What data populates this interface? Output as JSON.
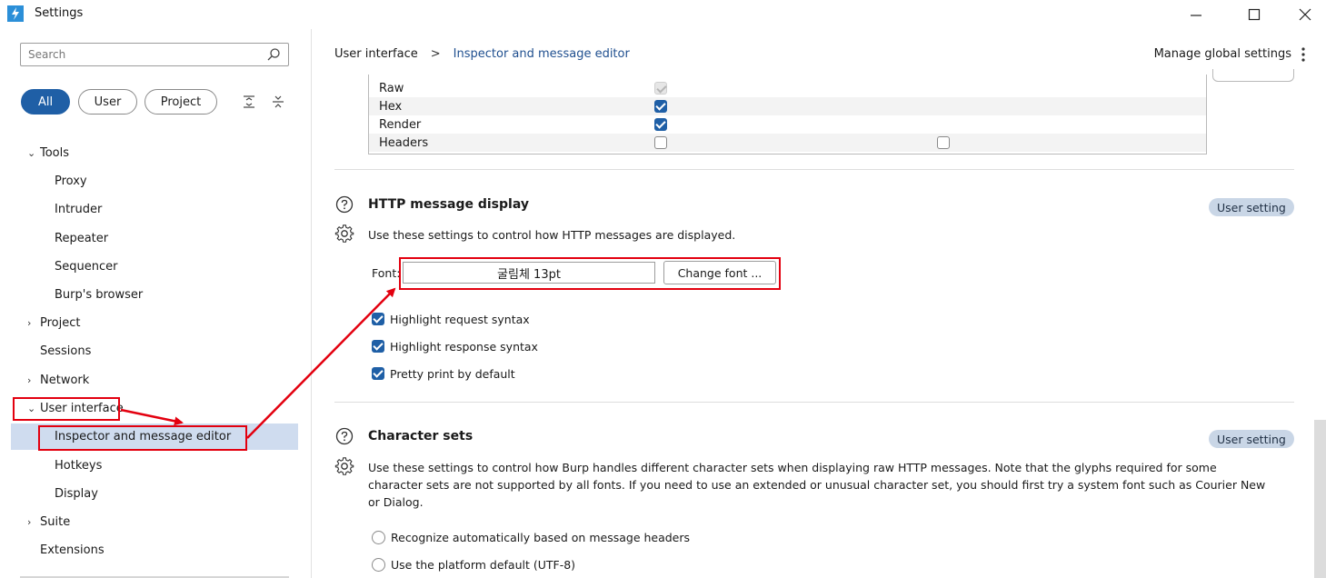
{
  "window": {
    "title": "Settings",
    "minimize_glyph": "—",
    "close_glyph": "✕"
  },
  "sidebar": {
    "search_placeholder": "Search",
    "filters": {
      "all": "All",
      "user": "User",
      "project": "Project",
      "active": "All"
    },
    "tree": [
      {
        "label": "Tools",
        "chevron": "⌄"
      },
      {
        "label": "Proxy"
      },
      {
        "label": "Intruder"
      },
      {
        "label": "Repeater"
      },
      {
        "label": "Sequencer"
      },
      {
        "label": "Burp's browser"
      },
      {
        "label": "Project",
        "chevron": "›"
      },
      {
        "label": "Sessions"
      },
      {
        "label": "Network",
        "chevron": "›"
      },
      {
        "label": "User interface",
        "chevron": "⌄"
      },
      {
        "label": "Inspector and message editor",
        "selected": true
      },
      {
        "label": "Hotkeys"
      },
      {
        "label": "Display"
      },
      {
        "label": "Suite",
        "chevron": "›"
      },
      {
        "label": "Extensions"
      }
    ]
  },
  "header": {
    "breadcrumb_parent": "User interface",
    "breadcrumb_separator": ">",
    "breadcrumb_current": "Inspector and message editor",
    "manage_label": "Manage global settings"
  },
  "view_table": {
    "rows": [
      {
        "label": "Raw",
        "state": "disabled-checked"
      },
      {
        "label": "Hex",
        "state": "checked"
      },
      {
        "label": "Render",
        "state": "checked"
      },
      {
        "label": "Headers",
        "state": "unchecked",
        "second_state": "unchecked"
      }
    ]
  },
  "http_display": {
    "title": "HTTP message display",
    "badge": "User setting",
    "description": "Use these settings to control how HTTP messages are displayed.",
    "font_label": "Font:",
    "font_value": "굴림체  13pt",
    "change_font_label": "Change font ...",
    "options": [
      {
        "label": "Highlight request syntax",
        "checked": true
      },
      {
        "label": "Highlight response syntax",
        "checked": true
      },
      {
        "label": "Pretty print by default",
        "checked": true
      }
    ]
  },
  "charsets": {
    "title": "Character sets",
    "badge": "User setting",
    "description_line1": "Use these settings to control how Burp handles different character sets when displaying raw HTTP messages. Note that the glyphs required for some",
    "description_line2": "character sets are not supported by all fonts. If you need to use an extended or unusual character set, you should first try a system font such as Courier New",
    "description_line3": "or Dialog.",
    "options": [
      {
        "label": "Recognize automatically based on message headers"
      },
      {
        "label": "Use the platform default (UTF-8)"
      }
    ]
  },
  "colors": {
    "accent": "#1f5fa6",
    "selection": "#cfdcef",
    "annotation": "#e3000f",
    "badge": "#c9d6e6"
  }
}
